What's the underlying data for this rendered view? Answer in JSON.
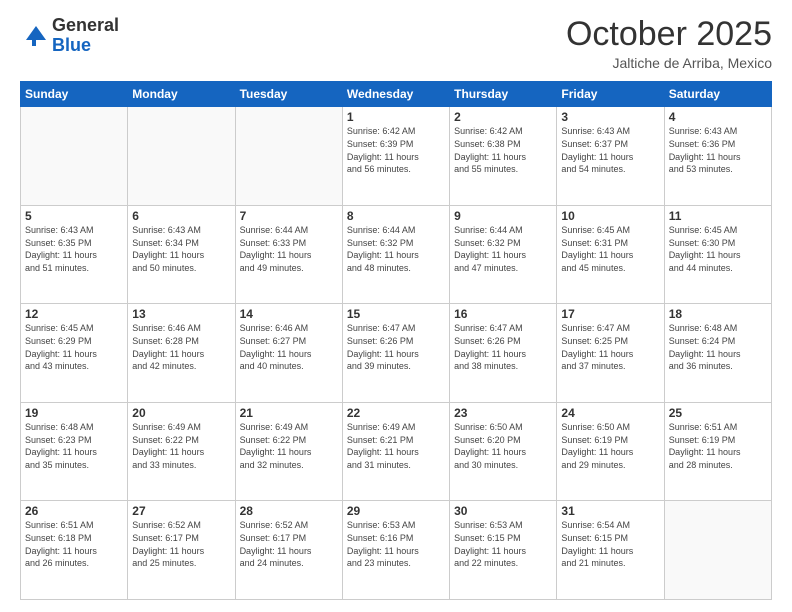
{
  "header": {
    "logo_general": "General",
    "logo_blue": "Blue",
    "month": "October 2025",
    "location": "Jaltiche de Arriba, Mexico"
  },
  "weekdays": [
    "Sunday",
    "Monday",
    "Tuesday",
    "Wednesday",
    "Thursday",
    "Friday",
    "Saturday"
  ],
  "weeks": [
    [
      {
        "day": "",
        "info": ""
      },
      {
        "day": "",
        "info": ""
      },
      {
        "day": "",
        "info": ""
      },
      {
        "day": "1",
        "info": "Sunrise: 6:42 AM\nSunset: 6:39 PM\nDaylight: 11 hours\nand 56 minutes."
      },
      {
        "day": "2",
        "info": "Sunrise: 6:42 AM\nSunset: 6:38 PM\nDaylight: 11 hours\nand 55 minutes."
      },
      {
        "day": "3",
        "info": "Sunrise: 6:43 AM\nSunset: 6:37 PM\nDaylight: 11 hours\nand 54 minutes."
      },
      {
        "day": "4",
        "info": "Sunrise: 6:43 AM\nSunset: 6:36 PM\nDaylight: 11 hours\nand 53 minutes."
      }
    ],
    [
      {
        "day": "5",
        "info": "Sunrise: 6:43 AM\nSunset: 6:35 PM\nDaylight: 11 hours\nand 51 minutes."
      },
      {
        "day": "6",
        "info": "Sunrise: 6:43 AM\nSunset: 6:34 PM\nDaylight: 11 hours\nand 50 minutes."
      },
      {
        "day": "7",
        "info": "Sunrise: 6:44 AM\nSunset: 6:33 PM\nDaylight: 11 hours\nand 49 minutes."
      },
      {
        "day": "8",
        "info": "Sunrise: 6:44 AM\nSunset: 6:32 PM\nDaylight: 11 hours\nand 48 minutes."
      },
      {
        "day": "9",
        "info": "Sunrise: 6:44 AM\nSunset: 6:32 PM\nDaylight: 11 hours\nand 47 minutes."
      },
      {
        "day": "10",
        "info": "Sunrise: 6:45 AM\nSunset: 6:31 PM\nDaylight: 11 hours\nand 45 minutes."
      },
      {
        "day": "11",
        "info": "Sunrise: 6:45 AM\nSunset: 6:30 PM\nDaylight: 11 hours\nand 44 minutes."
      }
    ],
    [
      {
        "day": "12",
        "info": "Sunrise: 6:45 AM\nSunset: 6:29 PM\nDaylight: 11 hours\nand 43 minutes."
      },
      {
        "day": "13",
        "info": "Sunrise: 6:46 AM\nSunset: 6:28 PM\nDaylight: 11 hours\nand 42 minutes."
      },
      {
        "day": "14",
        "info": "Sunrise: 6:46 AM\nSunset: 6:27 PM\nDaylight: 11 hours\nand 40 minutes."
      },
      {
        "day": "15",
        "info": "Sunrise: 6:47 AM\nSunset: 6:26 PM\nDaylight: 11 hours\nand 39 minutes."
      },
      {
        "day": "16",
        "info": "Sunrise: 6:47 AM\nSunset: 6:26 PM\nDaylight: 11 hours\nand 38 minutes."
      },
      {
        "day": "17",
        "info": "Sunrise: 6:47 AM\nSunset: 6:25 PM\nDaylight: 11 hours\nand 37 minutes."
      },
      {
        "day": "18",
        "info": "Sunrise: 6:48 AM\nSunset: 6:24 PM\nDaylight: 11 hours\nand 36 minutes."
      }
    ],
    [
      {
        "day": "19",
        "info": "Sunrise: 6:48 AM\nSunset: 6:23 PM\nDaylight: 11 hours\nand 35 minutes."
      },
      {
        "day": "20",
        "info": "Sunrise: 6:49 AM\nSunset: 6:22 PM\nDaylight: 11 hours\nand 33 minutes."
      },
      {
        "day": "21",
        "info": "Sunrise: 6:49 AM\nSunset: 6:22 PM\nDaylight: 11 hours\nand 32 minutes."
      },
      {
        "day": "22",
        "info": "Sunrise: 6:49 AM\nSunset: 6:21 PM\nDaylight: 11 hours\nand 31 minutes."
      },
      {
        "day": "23",
        "info": "Sunrise: 6:50 AM\nSunset: 6:20 PM\nDaylight: 11 hours\nand 30 minutes."
      },
      {
        "day": "24",
        "info": "Sunrise: 6:50 AM\nSunset: 6:19 PM\nDaylight: 11 hours\nand 29 minutes."
      },
      {
        "day": "25",
        "info": "Sunrise: 6:51 AM\nSunset: 6:19 PM\nDaylight: 11 hours\nand 28 minutes."
      }
    ],
    [
      {
        "day": "26",
        "info": "Sunrise: 6:51 AM\nSunset: 6:18 PM\nDaylight: 11 hours\nand 26 minutes."
      },
      {
        "day": "27",
        "info": "Sunrise: 6:52 AM\nSunset: 6:17 PM\nDaylight: 11 hours\nand 25 minutes."
      },
      {
        "day": "28",
        "info": "Sunrise: 6:52 AM\nSunset: 6:17 PM\nDaylight: 11 hours\nand 24 minutes."
      },
      {
        "day": "29",
        "info": "Sunrise: 6:53 AM\nSunset: 6:16 PM\nDaylight: 11 hours\nand 23 minutes."
      },
      {
        "day": "30",
        "info": "Sunrise: 6:53 AM\nSunset: 6:15 PM\nDaylight: 11 hours\nand 22 minutes."
      },
      {
        "day": "31",
        "info": "Sunrise: 6:54 AM\nSunset: 6:15 PM\nDaylight: 11 hours\nand 21 minutes."
      },
      {
        "day": "",
        "info": ""
      }
    ]
  ]
}
